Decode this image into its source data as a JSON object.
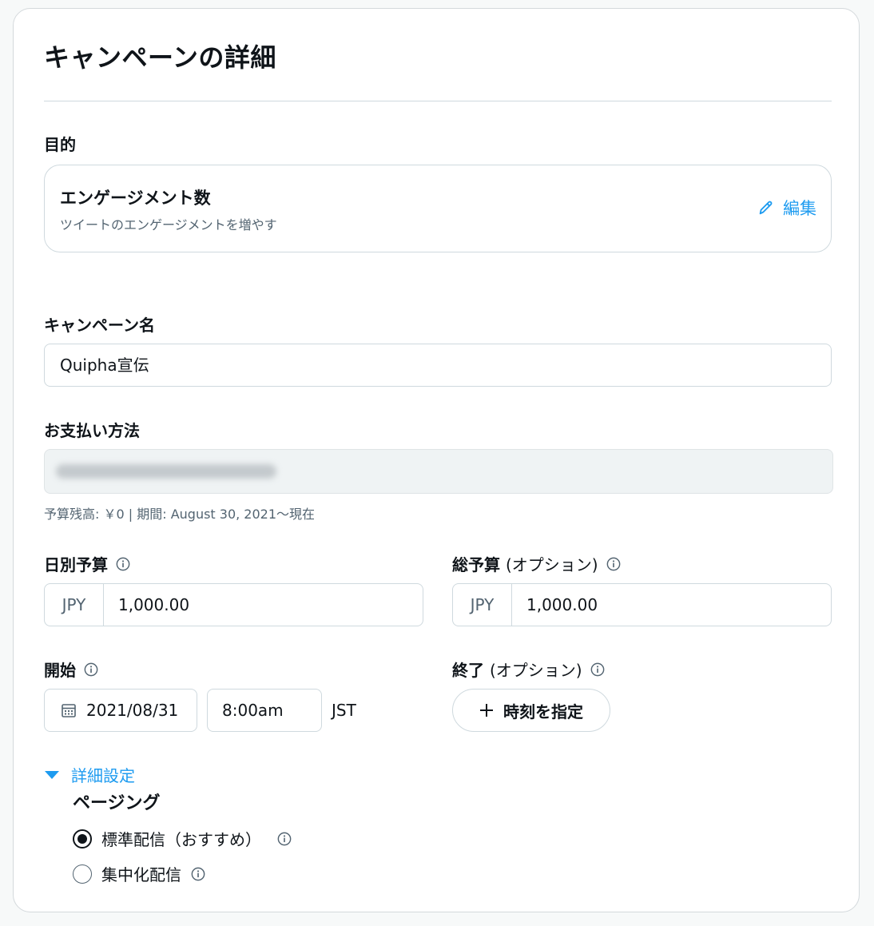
{
  "page": {
    "title": "キャンペーンの詳細"
  },
  "objective": {
    "label": "目的",
    "name": "エンゲージメント数",
    "description": "ツイートのエンゲージメントを増やす",
    "edit_label": "編集"
  },
  "campaign_name": {
    "label": "キャンペーン名",
    "value": "Quipha宣伝"
  },
  "payment": {
    "label": "お支払い方法",
    "note": "予算残高: ￥0 | 期間: August 30, 2021～現在"
  },
  "daily_budget": {
    "label": "日別予算",
    "currency": "JPY",
    "value": "1,000.00"
  },
  "total_budget": {
    "label": "総予算",
    "optional": "(オプション)",
    "currency": "JPY",
    "value": "1,000.00"
  },
  "start": {
    "label": "開始",
    "date": "2021/08/31",
    "time": "8:00am",
    "timezone": "JST"
  },
  "end": {
    "label": "終了",
    "optional": "(オプション)",
    "button_label": "時刻を指定"
  },
  "advanced": {
    "toggle_label": "詳細設定",
    "pacing_label": "ページング",
    "options": [
      {
        "label": "標準配信（おすすめ）",
        "selected": true
      },
      {
        "label": "集中化配信",
        "selected": false
      }
    ]
  },
  "colors": {
    "accent": "#1d9bf0",
    "text": "#0f1419",
    "muted": "#536471",
    "border": "#cfd9de"
  }
}
